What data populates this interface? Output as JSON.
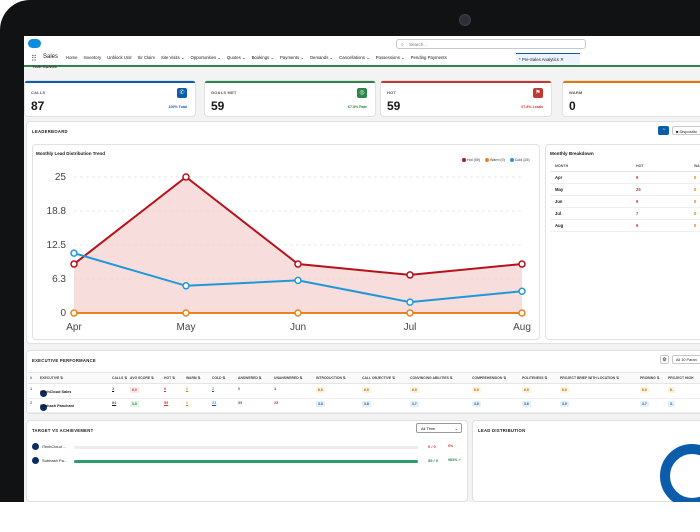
{
  "app": {
    "name": "Sales",
    "search_placeholder": "Search..."
  },
  "nav": {
    "items": [
      "Home",
      "Inventory",
      "Unblock Unit",
      "Sir Claim",
      "Site Visits ⌄",
      "Opportunities ⌄",
      "Quotes ⌄",
      "Bookings ⌄",
      "Payments ⌄",
      "Demands ⌄",
      "Cancellations ⌄",
      "Possessions ⌄",
      "Pending Payments"
    ],
    "active_tab": "* Pre-Sales Analytics  ✕"
  },
  "section_label": "TIME RANGE",
  "cards": [
    {
      "title": "CALLS",
      "value": "87",
      "sub": "100% Total",
      "color": "#0b5cab",
      "icon": "phone-icon",
      "glyph": "✆"
    },
    {
      "title": "GOALS MET",
      "value": "59",
      "sub": "67.8% Rate",
      "color": "#2e844a",
      "icon": "target-icon",
      "glyph": "◎"
    },
    {
      "title": "HOT",
      "value": "59",
      "sub": "67.8% Leads",
      "color": "#c23934",
      "icon": "flag-icon",
      "glyph": "⚑"
    },
    {
      "title": "WARM",
      "value": "0",
      "sub": "",
      "color": "#dd7a01",
      "icon": "",
      "glyph": ""
    }
  ],
  "leaderboard": {
    "title": "LEADERBOARD",
    "button_label": "■ Dispositio"
  },
  "chart_data": {
    "type": "line",
    "title": "Monthly Lead Distribution Trend",
    "categories": [
      "Apr",
      "May",
      "Jun",
      "Jul",
      "Aug"
    ],
    "series": [
      {
        "name": "Hot (59)",
        "color": "#b5121b",
        "values": [
          9,
          25,
          9,
          7,
          9
        ]
      },
      {
        "name": "Warm (0)",
        "color": "#e8821a",
        "values": [
          0,
          0,
          0,
          0,
          0
        ]
      },
      {
        "name": "Cold (25)",
        "color": "#1e98d8",
        "values": [
          11,
          5,
          6,
          2,
          4
        ]
      }
    ],
    "yticks": [
      "0",
      "6.3",
      "12.5",
      "18.8",
      "25"
    ],
    "ylim": [
      0,
      25
    ],
    "grid": true,
    "legend": "top-right"
  },
  "monthly_breakdown": {
    "title": "Monthly Breakdown",
    "headers": [
      "MONTH",
      "HOT",
      "WA"
    ],
    "rows": [
      {
        "month": "Apr",
        "hot": "9",
        "warm": "0"
      },
      {
        "month": "May",
        "hot": "25",
        "warm": "0"
      },
      {
        "month": "Jun",
        "hot": "9",
        "warm": "0"
      },
      {
        "month": "Jul",
        "hot": "7",
        "warm": "0"
      },
      {
        "month": "Aug",
        "hot": "6",
        "warm": "0"
      }
    ]
  },
  "executive": {
    "title": "EXECUTIVE PERFORMANCE",
    "param_label": "All 10 Paran",
    "headers": [
      "#",
      "EXECUTIVE ⇅",
      "CALLS ⇅",
      "AVG SCORE ⇅",
      "HOT ⇅",
      "WARM ⇅",
      "COLD ⇅",
      "ANSWERED ⇅",
      "UNANSWERED ⇅",
      "INTRODUCTION ⇅",
      "CALL OBJECTIVE ⇅",
      "CONVINCING ABILITIES ⇅",
      "COMPREHENSION ⇅",
      "POLITENESS ⇅",
      "PROJECT BRIEF WITH LOCATION ⇅",
      "PROBING ⇅",
      "PROJECT HIGH"
    ],
    "rows": [
      {
        "idx": "1",
        "name": "iTechCloud Sales",
        "calls": "3",
        "avg": "6.0",
        "hot": "0",
        "warm": "0",
        "cold": "2",
        "answered": "0",
        "unanswered": "3",
        "intro": "6.0",
        "obj": "6.0",
        "conv": "6.0",
        "comp": "6.0",
        "pol": "6.0",
        "brief": "6.0",
        "prob": "6.0",
        "high": "6."
      },
      {
        "idx": "2",
        "name": "Subhash Panchani",
        "calls": "84",
        "avg": "3.8",
        "hot": "59",
        "warm": "0",
        "cold": "23",
        "answered": "59",
        "unanswered": "25",
        "intro": "3.8",
        "obj": "3.8",
        "conv": "3.7",
        "comp": "3.8",
        "pol": "3.6",
        "brief": "3.9",
        "prob": "3.7",
        "high": "3."
      }
    ]
  },
  "target": {
    "title": "TARGET VS ACHIEVEMENT",
    "filter": "All Time",
    "rows": [
      {
        "name": "iTechCloud ...",
        "score": "0 / 0",
        "pct": "0%",
        "progress": 0,
        "color": "#c23934"
      },
      {
        "name": "Subhash Pa...",
        "score": "59 / 0",
        "pct": "983% ✓",
        "progress": 1,
        "color": "#2e844a"
      }
    ]
  },
  "lead_distribution": {
    "title": "LEAD DISTRIBUTION"
  }
}
